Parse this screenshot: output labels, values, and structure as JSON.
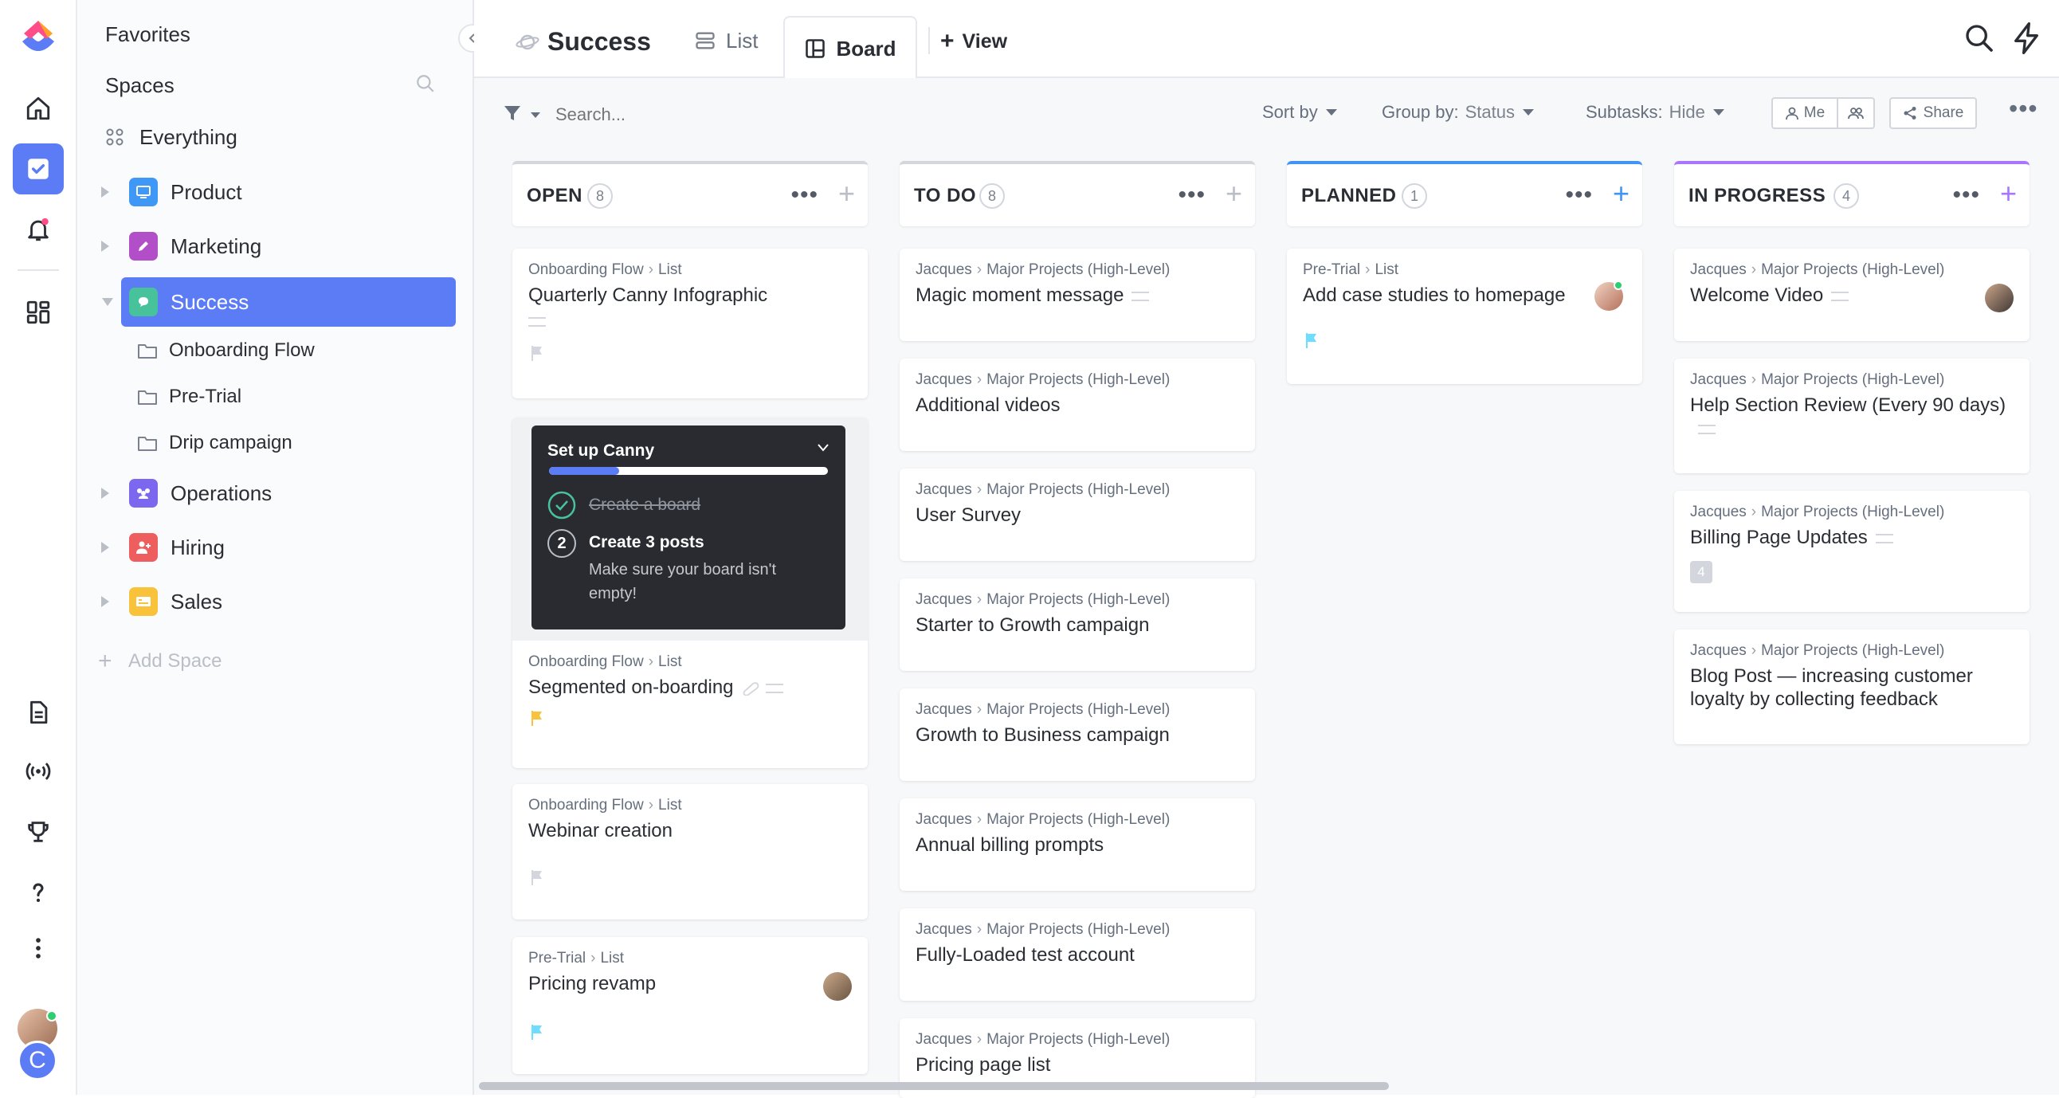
{
  "sidebar": {
    "favorites": "Favorites",
    "spaces": "Spaces",
    "everything": "Everything",
    "spaces_list": [
      {
        "label": "Product",
        "color": "#3f98f6"
      },
      {
        "label": "Marketing",
        "color": "#b34ec9"
      },
      {
        "label": "Success",
        "color": "#48c29b"
      },
      {
        "label": "Operations",
        "color": "#7b68ee"
      },
      {
        "label": "Hiring",
        "color": "#ee5e5e"
      },
      {
        "label": "Sales",
        "color": "#f8c23a"
      }
    ],
    "folders": [
      "Onboarding Flow",
      "Pre-Trial",
      "Drip campaign"
    ],
    "add_space": "Add Space"
  },
  "header": {
    "title": "Success",
    "tabs": [
      {
        "label": "List",
        "active": false
      },
      {
        "label": "Board",
        "active": true
      }
    ],
    "add_view": "View"
  },
  "toolbar": {
    "search_placeholder": "Search...",
    "sort_by": "Sort by",
    "group_by_label": "Group by:",
    "group_by_value": "Status",
    "subtasks_label": "Subtasks:",
    "subtasks_value": "Hide",
    "me": "Me",
    "share": "Share"
  },
  "columns": [
    {
      "title": "OPEN",
      "count": "8",
      "color": "#d3d6dc",
      "cards": [
        {
          "crumb_a": "Onboarding Flow",
          "crumb_b": "List",
          "title": "Quarterly Canny Infographic"
        },
        {
          "crumb_a": "Onboarding Flow",
          "crumb_b": "List",
          "title": "Segmented on-boarding"
        },
        {
          "crumb_a": "Onboarding Flow",
          "crumb_b": "List",
          "title": "Webinar creation"
        },
        {
          "crumb_a": "Pre-Trial",
          "crumb_b": "List",
          "title": "Pricing revamp"
        }
      ]
    },
    {
      "title": "TO DO",
      "count": "8",
      "color": "#d3d6dc",
      "cards": [
        {
          "crumb_a": "Jacques",
          "crumb_b": "Major Projects (High-Level)",
          "title": "Magic moment message"
        },
        {
          "crumb_a": "Jacques",
          "crumb_b": "Major Projects (High-Level)",
          "title": "Additional videos"
        },
        {
          "crumb_a": "Jacques",
          "crumb_b": "Major Projects (High-Level)",
          "title": "User Survey"
        },
        {
          "crumb_a": "Jacques",
          "crumb_b": "Major Projects (High-Level)",
          "title": "Starter to Growth campaign"
        },
        {
          "crumb_a": "Jacques",
          "crumb_b": "Major Projects (High-Level)",
          "title": "Growth to Business campaign"
        },
        {
          "crumb_a": "Jacques",
          "crumb_b": "Major Projects (High-Level)",
          "title": "Annual billing prompts"
        },
        {
          "crumb_a": "Jacques",
          "crumb_b": "Major Projects (High-Level)",
          "title": "Fully-Loaded test account"
        },
        {
          "crumb_a": "Jacques",
          "crumb_b": "Major Projects (High-Level)",
          "title": "Pricing page list"
        }
      ]
    },
    {
      "title": "PLANNED",
      "count": "1",
      "color": "#4194f6",
      "cards": [
        {
          "crumb_a": "Pre-Trial",
          "crumb_b": "List",
          "title": "Add case studies to homepage"
        }
      ]
    },
    {
      "title": "IN PROGRESS",
      "count": "4",
      "color": "#a875ff",
      "cards": [
        {
          "crumb_a": "Jacques",
          "crumb_b": "Major Projects (High-Level)",
          "title": "Welcome Video"
        },
        {
          "crumb_a": "Jacques",
          "crumb_b": "Major Projects (High-Level)",
          "title": "Help Section Review (Every 90 days)"
        },
        {
          "crumb_a": "Jacques",
          "crumb_b": "Major Projects (High-Level)",
          "title": "Billing Page Updates",
          "subtask_count": "4"
        },
        {
          "crumb_a": "Jacques",
          "crumb_b": "Major Projects (High-Level)",
          "title": "Blog Post — increasing customer loyalty by collecting feedback"
        }
      ]
    }
  ],
  "onboarding": {
    "title": "Set up Canny",
    "progress": 0.25,
    "step1": "Create a board",
    "step2_num": "2",
    "step2_title": "Create 3 posts",
    "step2_desc": "Make sure your board isn't empty!"
  }
}
